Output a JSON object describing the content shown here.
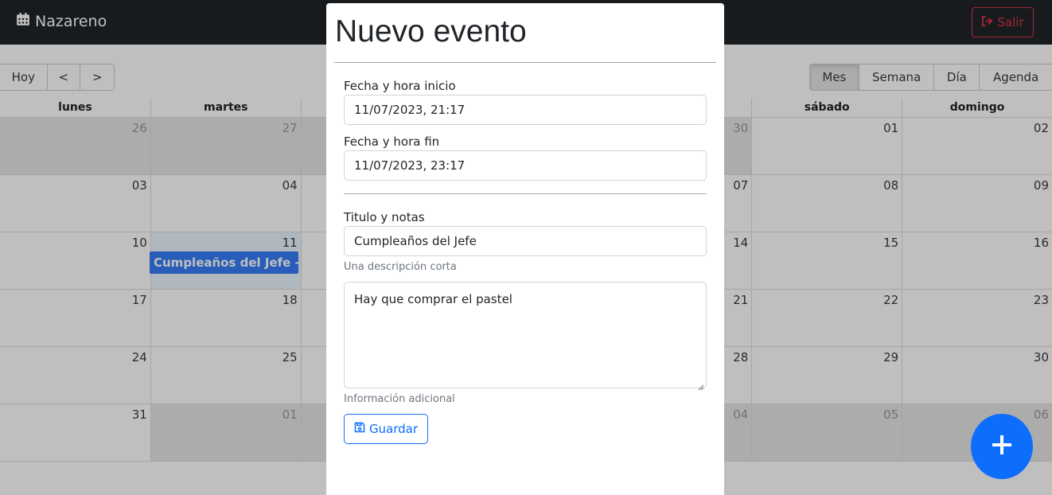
{
  "navbar": {
    "brand": "Nazareno",
    "brand_icon": "calendar-icon",
    "logout_label": "Salir",
    "logout_icon": "sign-out-icon"
  },
  "colors": {
    "navbar": "#212529",
    "danger": "#dc3545",
    "primary": "#0d6efd",
    "event": "#367cf7"
  },
  "toolbar": {
    "nav": [
      "Hoy",
      "<",
      ">"
    ],
    "views": [
      {
        "label": "Mes",
        "active": true
      },
      {
        "label": "Semana",
        "active": false
      },
      {
        "label": "Día",
        "active": false
      },
      {
        "label": "Agenda",
        "active": false
      }
    ]
  },
  "calendar": {
    "weekdays": [
      "lunes",
      "martes",
      "",
      "",
      "",
      "sábado",
      "domingo"
    ],
    "weeks": [
      [
        {
          "d": "26",
          "off": true
        },
        {
          "d": "27",
          "off": true
        },
        {
          "d": "",
          "off": true
        },
        {
          "d": "",
          "off": true
        },
        {
          "d": "30",
          "off": true
        },
        {
          "d": "01",
          "off": false
        },
        {
          "d": "02",
          "off": false
        }
      ],
      [
        {
          "d": "03",
          "off": false
        },
        {
          "d": "04",
          "off": false
        },
        {
          "d": "",
          "off": false
        },
        {
          "d": "",
          "off": false
        },
        {
          "d": "07",
          "off": false
        },
        {
          "d": "08",
          "off": false
        },
        {
          "d": "09",
          "off": false
        }
      ],
      [
        {
          "d": "10",
          "off": false
        },
        {
          "d": "11",
          "off": false,
          "today": true
        },
        {
          "d": "",
          "off": false
        },
        {
          "d": "",
          "off": false
        },
        {
          "d": "14",
          "off": false
        },
        {
          "d": "15",
          "off": false
        },
        {
          "d": "16",
          "off": false
        }
      ],
      [
        {
          "d": "17",
          "off": false
        },
        {
          "d": "18",
          "off": false
        },
        {
          "d": "",
          "off": false
        },
        {
          "d": "",
          "off": false
        },
        {
          "d": "21",
          "off": false
        },
        {
          "d": "22",
          "off": false
        },
        {
          "d": "23",
          "off": false
        }
      ],
      [
        {
          "d": "24",
          "off": false
        },
        {
          "d": "25",
          "off": false
        },
        {
          "d": "",
          "off": false
        },
        {
          "d": "",
          "off": false
        },
        {
          "d": "28",
          "off": false
        },
        {
          "d": "29",
          "off": false
        },
        {
          "d": "30",
          "off": false
        }
      ],
      [
        {
          "d": "31",
          "off": false
        },
        {
          "d": "01",
          "off": true
        },
        {
          "d": "",
          "off": true
        },
        {
          "d": "",
          "off": true
        },
        {
          "d": "04",
          "off": true
        },
        {
          "d": "05",
          "off": true
        },
        {
          "d": "06",
          "off": true
        }
      ]
    ],
    "event": {
      "title": "Cumpleaños del Jefe -..."
    }
  },
  "fab": {
    "icon": "plus-icon"
  },
  "modal": {
    "title": "Nuevo evento",
    "start_label": "Fecha y hora inicio",
    "start_value": "11/07/2023, 21:17",
    "end_label": "Fecha y hora fin",
    "end_value": "11/07/2023, 23:17",
    "title_label": "Titulo y notas",
    "title_value": "Cumpleaños del Jefe",
    "title_help": "Una descripción corta",
    "notes_value": "Hay que comprar el pastel",
    "notes_help": "Información adicional",
    "save_label": "Guardar",
    "save_icon": "floppy-disk-icon"
  }
}
